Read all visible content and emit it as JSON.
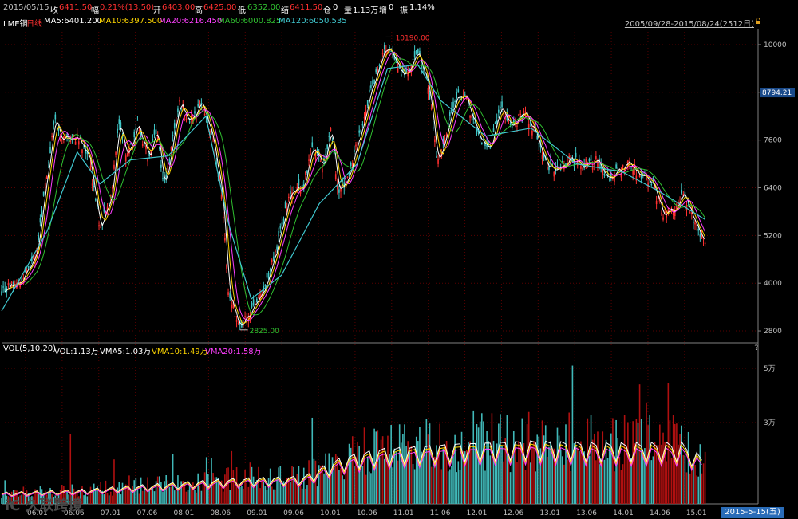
{
  "topbar": {
    "date": "2015/05/15",
    "close_label": "收",
    "close_value": "6411.50",
    "chg_label": "幅",
    "chg_value": "0.21%(13.50)",
    "open_label": "开",
    "open_value": "6403.00",
    "high_label": "高",
    "high_value": "6425.00",
    "low_label": "低",
    "low_value": "6352.00",
    "settle_label": "结",
    "settle_value": "6411.50",
    "oi_label": "仓",
    "oi_value": "0",
    "vol_label": "量",
    "vol_value": "1.13万",
    "inc_label": "增",
    "inc_value": "0",
    "amp_label": "振",
    "amp_value": "1.14%"
  },
  "mabar": {
    "instrument": "LME铜",
    "period": "日线",
    "ma5": "MA5:6401.200",
    "ma10": "MA10:6397.500",
    "ma20": "MA20:6216.450",
    "ma60": "MA60:6000.825",
    "ma120": "MA120:6050.535"
  },
  "range_text": "2005/09/28-2015/08/24(2512日)",
  "volbar": {
    "name": "VOL(5,10,20)",
    "vol": "VOL:1.13万",
    "vma5": "VMA5:1.03万",
    "vma10": "VMA10:1.49万",
    "vma20": "VMA20:1.58万"
  },
  "question_mark": "?",
  "date_badge": "2015-5-15(五)",
  "watermark": "iC 久联跨境",
  "colors": {
    "background": "#000000",
    "up": "#ff3030",
    "down": "#40c8c8",
    "ma5": "#ffffff",
    "ma10": "#ffd700",
    "ma20": "#ff40ff",
    "ma60": "#30c030",
    "ma120": "#40c8d0",
    "grid": "#5a0000",
    "axis": "#c0c0c0",
    "current_price_box": "#1a4a8a"
  },
  "chart_data": {
    "type": "candlestick",
    "price_axis": {
      "ticks": [
        2800,
        4000,
        5200,
        6400,
        7600,
        8800,
        10000
      ],
      "ylim": [
        2500,
        10400
      ],
      "current_price_label": "8794.21",
      "current_price": 8794.21
    },
    "annotations": {
      "high_label": "10190.00",
      "high": 10190,
      "low_label": "2825.00",
      "low": 2825
    },
    "x_ticks": [
      "06.01",
      "06.06",
      "07.01",
      "07.06",
      "08.01",
      "08.06",
      "09.01",
      "09.06",
      "10.01",
      "10.06",
      "11.01",
      "11.06",
      "12.01",
      "12.06",
      "13.01",
      "13.06",
      "14.01",
      "14.06",
      "15.01"
    ],
    "price_path": {
      "series": "close (approx.)",
      "points": [
        [
          0,
          3800
        ],
        [
          0.02,
          4000
        ],
        [
          0.045,
          4600
        ],
        [
          0.06,
          6800
        ],
        [
          0.07,
          8100
        ],
        [
          0.08,
          7600
        ],
        [
          0.1,
          7700
        ],
        [
          0.115,
          7200
        ],
        [
          0.13,
          5400
        ],
        [
          0.145,
          6200
        ],
        [
          0.155,
          8100
        ],
        [
          0.165,
          7200
        ],
        [
          0.18,
          8000
        ],
        [
          0.195,
          7100
        ],
        [
          0.205,
          7900
        ],
        [
          0.215,
          6400
        ],
        [
          0.235,
          8500
        ],
        [
          0.25,
          8100
        ],
        [
          0.265,
          8600
        ],
        [
          0.28,
          7500
        ],
        [
          0.29,
          6400
        ],
        [
          0.3,
          3800
        ],
        [
          0.315,
          2900
        ],
        [
          0.33,
          3300
        ],
        [
          0.345,
          3700
        ],
        [
          0.36,
          4700
        ],
        [
          0.38,
          6100
        ],
        [
          0.4,
          6500
        ],
        [
          0.41,
          7500
        ],
        [
          0.425,
          6900
        ],
        [
          0.435,
          7800
        ],
        [
          0.445,
          6300
        ],
        [
          0.46,
          6700
        ],
        [
          0.48,
          8300
        ],
        [
          0.5,
          9600
        ],
        [
          0.51,
          10000
        ],
        [
          0.52,
          9500
        ],
        [
          0.535,
          9200
        ],
        [
          0.55,
          9800
        ],
        [
          0.565,
          8900
        ],
        [
          0.575,
          7100
        ],
        [
          0.585,
          7500
        ],
        [
          0.6,
          8700
        ],
        [
          0.615,
          8600
        ],
        [
          0.63,
          7700
        ],
        [
          0.645,
          7400
        ],
        [
          0.66,
          8400
        ],
        [
          0.675,
          7900
        ],
        [
          0.69,
          8300
        ],
        [
          0.705,
          7800
        ],
        [
          0.72,
          7000
        ],
        [
          0.735,
          6800
        ],
        [
          0.75,
          7100
        ],
        [
          0.77,
          7000
        ],
        [
          0.785,
          7100
        ],
        [
          0.8,
          6600
        ],
        [
          0.815,
          6800
        ],
        [
          0.83,
          7000
        ],
        [
          0.845,
          6700
        ],
        [
          0.86,
          6500
        ],
        [
          0.875,
          5700
        ],
        [
          0.89,
          5900
        ],
        [
          0.9,
          6300
        ],
        [
          0.91,
          5800
        ],
        [
          0.93,
          5000
        ]
      ]
    },
    "ma120_path": {
      "points": [
        [
          0,
          3300
        ],
        [
          0.06,
          5300
        ],
        [
          0.1,
          7300
        ],
        [
          0.13,
          6500
        ],
        [
          0.17,
          7100
        ],
        [
          0.22,
          7200
        ],
        [
          0.27,
          8200
        ],
        [
          0.3,
          5500
        ],
        [
          0.33,
          3600
        ],
        [
          0.37,
          4200
        ],
        [
          0.42,
          6000
        ],
        [
          0.47,
          7000
        ],
        [
          0.51,
          9400
        ],
        [
          0.55,
          9500
        ],
        [
          0.58,
          8600
        ],
        [
          0.64,
          7700
        ],
        [
          0.7,
          7900
        ],
        [
          0.76,
          7000
        ],
        [
          0.82,
          6800
        ],
        [
          0.87,
          6300
        ],
        [
          0.93,
          5600
        ]
      ]
    },
    "volume_axis": {
      "ticks": [
        "3万",
        "5万"
      ],
      "tick_values": [
        30000,
        50000
      ],
      "ylim": [
        0,
        55000
      ]
    },
    "volume_profile": {
      "points": [
        [
          0,
          4000
        ],
        [
          0.1,
          5000
        ],
        [
          0.2,
          7000
        ],
        [
          0.3,
          9000
        ],
        [
          0.4,
          10000
        ],
        [
          0.45,
          17000
        ],
        [
          0.5,
          20000
        ],
        [
          0.6,
          22000
        ],
        [
          0.7,
          23000
        ],
        [
          0.8,
          22000
        ],
        [
          0.9,
          22000
        ],
        [
          0.93,
          16000
        ]
      ]
    }
  }
}
